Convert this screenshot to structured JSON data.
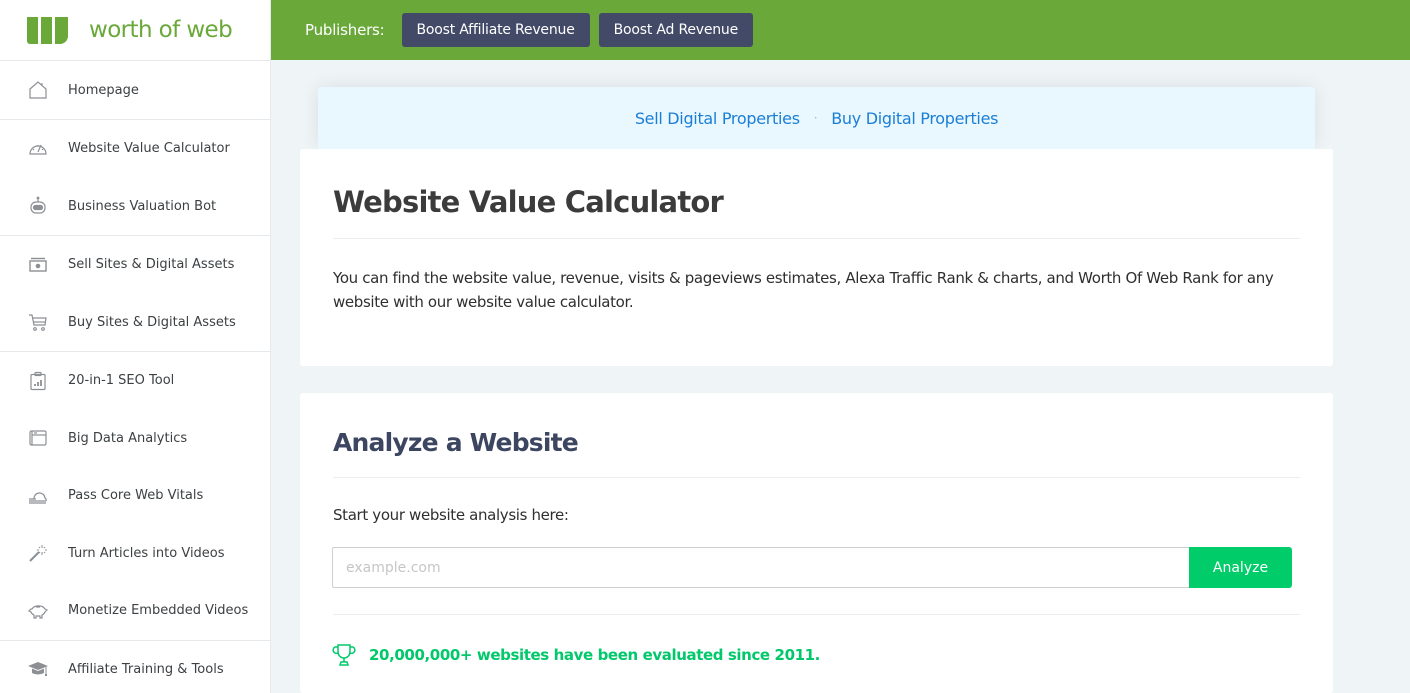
{
  "brand": {
    "name": "worth of web",
    "color": "#6aa83a"
  },
  "topbar": {
    "label": "Publishers:",
    "buttons": [
      {
        "label": "Boost Affiliate Revenue"
      },
      {
        "label": "Boost Ad Revenue"
      }
    ]
  },
  "sidebar": {
    "groups": [
      {
        "items": [
          {
            "label": "Homepage",
            "icon": "home-icon"
          }
        ]
      },
      {
        "items": [
          {
            "label": "Website Value Calculator",
            "icon": "speedometer-icon"
          },
          {
            "label": "Business Valuation Bot",
            "icon": "robot-icon"
          }
        ]
      },
      {
        "items": [
          {
            "label": "Sell Sites & Digital Assets",
            "icon": "money-icon"
          },
          {
            "label": "Buy Sites & Digital Assets",
            "icon": "cart-icon"
          }
        ]
      },
      {
        "items": [
          {
            "label": "20-in-1 SEO Tool",
            "icon": "clipboard-chart-icon"
          },
          {
            "label": "Big Data Analytics",
            "icon": "window-icon"
          },
          {
            "label": "Pass Core Web Vitals",
            "icon": "cloud-speed-icon"
          },
          {
            "label": "Turn Articles into Videos",
            "icon": "magic-wand-icon"
          },
          {
            "label": "Monetize Embedded Videos",
            "icon": "piggy-bank-icon"
          }
        ]
      },
      {
        "items": [
          {
            "label": "Affiliate Training & Tools",
            "icon": "graduation-cap-icon"
          }
        ]
      }
    ]
  },
  "promo": {
    "links": [
      {
        "label": "Sell Digital Properties"
      },
      {
        "label": "Buy Digital Properties"
      }
    ],
    "separator": "·"
  },
  "intro": {
    "title": "Website Value Calculator",
    "description": "You can find the website value, revenue, visits & pageviews estimates, Alexa Traffic Rank & charts, and Worth Of Web Rank for any website with our website value calculator."
  },
  "analyze": {
    "title": "Analyze a Website",
    "prompt": "Start your website analysis here:",
    "input_value": "",
    "input_placeholder": "example.com",
    "button_label": "Analyze",
    "button_color": "#01cc6a",
    "stat_text": "20,000,000+ websites have been evaluated since 2011."
  }
}
